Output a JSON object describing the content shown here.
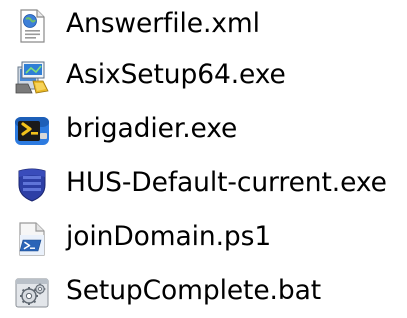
{
  "files": [
    {
      "name": "Answerfile.xml",
      "icon": "xml-document-icon"
    },
    {
      "name": "AsixSetup64.exe",
      "icon": "installer-setup-icon"
    },
    {
      "name": "brigadier.exe",
      "icon": "terminal-executable-icon"
    },
    {
      "name": "HUS-Default-current.exe",
      "icon": "shield-executable-icon"
    },
    {
      "name": "joinDomain.ps1",
      "icon": "powershell-script-icon"
    },
    {
      "name": "SetupComplete.bat",
      "icon": "batch-file-gears-icon"
    }
  ],
  "colors": {
    "background": "#ffffff",
    "text": "#000000",
    "powershell_blue": "#2a64b8",
    "shield_blue": "#2d3fa6",
    "terminal_yellow": "#f2c21b"
  }
}
